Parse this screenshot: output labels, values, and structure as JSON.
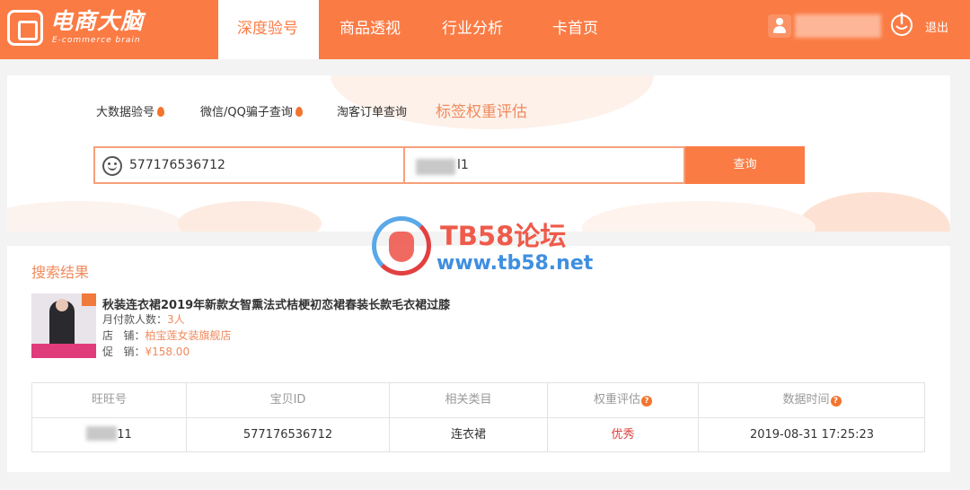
{
  "brand": {
    "title": "电商大脑",
    "subtitle": "E-commerce brain"
  },
  "nav": {
    "items": [
      {
        "label": "深度验号",
        "active": true
      },
      {
        "label": "商品透视",
        "active": false
      },
      {
        "label": "行业分析",
        "active": false
      },
      {
        "label": "卡首页",
        "active": false
      }
    ]
  },
  "user": {
    "logout_label": "退出",
    "icons": [
      "user-icon",
      "logout-icon"
    ]
  },
  "search": {
    "tabs": [
      {
        "label": "大数据验号",
        "hot": true
      },
      {
        "label": "微信/QQ骗子查询",
        "hot": true
      },
      {
        "label": "淘客订单查询",
        "hot": false
      },
      {
        "label": "标签权重评估",
        "active": true
      }
    ],
    "item_id_value": "577176536712",
    "account_value_suffix": "l1",
    "button_label": "查询"
  },
  "watermark": {
    "title": "TB58论坛",
    "url": "www.tb58.net"
  },
  "results": {
    "title": "搜索结果",
    "product": {
      "title": "秋装连衣裙2019年新款女智熏法式桔梗初恋裙春装长款毛衣裙过膝",
      "monthly_buyers_label": "月付款人数：",
      "monthly_buyers_value": "3人",
      "shop_label": "店   铺：",
      "shop_value": "柏宝莲女装旗舰店",
      "promo_label": "促   销：",
      "promo_value": "¥158.00"
    },
    "table": {
      "headers": [
        "旺旺号",
        "宝贝ID",
        "相关类目",
        "权重评估",
        "数据时间"
      ],
      "rows": [
        {
          "wangwang_suffix": "11",
          "item_id": "577176536712",
          "category": "连衣裙",
          "weight": "优秀",
          "time": "2019-08-31 17:25:23"
        }
      ]
    }
  },
  "colors": {
    "brand": "#fb7b44",
    "accent_text": "#f08a5c",
    "good": "#e23b3b"
  }
}
